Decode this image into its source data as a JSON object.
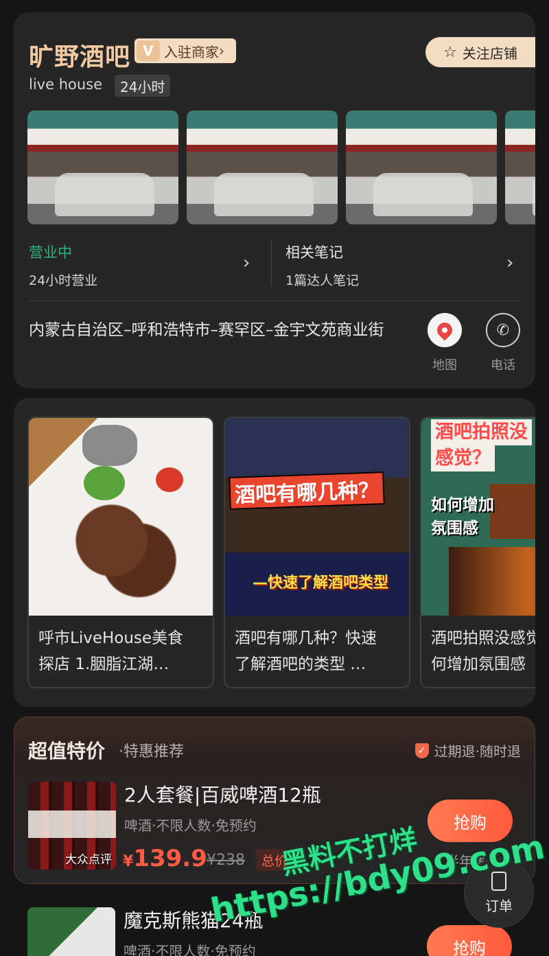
{
  "shop": {
    "name": "旷野酒吧",
    "badge_mark": "V",
    "badge_label": "入驻商家",
    "badge_chevron": "›",
    "follow_label": "关注店铺",
    "follow_icon": "☆",
    "tag_type": "live house",
    "tag_hours": "24小时",
    "status": "营业中",
    "hours_text": "24小时营业",
    "notes_title": "相关笔记",
    "notes_count": "1篇达人笔记",
    "chevron": "›",
    "address": "内蒙古自治区–呼和浩特市–赛罕区–金宇文苑商业街",
    "map_label": "地图",
    "phone_label": "电话",
    "phone_icon": "✆"
  },
  "notes": [
    {
      "title_line1": "呼市LiveHouse美食",
      "title_line2": "探店 1.胭脂江湖…"
    },
    {
      "title_line1": "酒吧有哪几种？快速",
      "title_line2": "了解酒吧的类型 …",
      "overlay_title": "酒吧有哪几种？",
      "overlay_sub": "—快速了解酒吧类型"
    },
    {
      "title_line1": "酒吧拍照没感觉？如",
      "title_line2": "何增加氛围感",
      "overlay_title": "酒吧拍照没",
      "overlay_title2": "感觉？",
      "overlay_sub": "如何增加氛围感"
    }
  ],
  "deals": {
    "title": "超值特价",
    "subtitle": "·特惠推荐",
    "guarantee": "过期退·随时退",
    "guarantee_icon": "✓",
    "items": [
      {
        "name": "2人套餐|百威啤酒12瓶",
        "meta": "啤酒·不限人数·免预约",
        "currency": "¥",
        "price": "139.9",
        "original_price": "¥238",
        "tag": "总价",
        "buy_label": "抢购",
        "sold": "半年售",
        "watermark": "大众点评"
      },
      {
        "name": "魔克斯熊猫24瓶",
        "meta": "啤酒·不限人数·免预约",
        "buy_label": "抢购"
      }
    ]
  },
  "order": {
    "label": "订单"
  },
  "watermark": {
    "line1": "黑料不打烊",
    "line2": "https://bdy09.com"
  },
  "colors": {
    "accent": "#f1c9a3",
    "open_green": "#2fb27c",
    "price_red": "#ff5a44",
    "watermark_green": "#2fe08a"
  }
}
